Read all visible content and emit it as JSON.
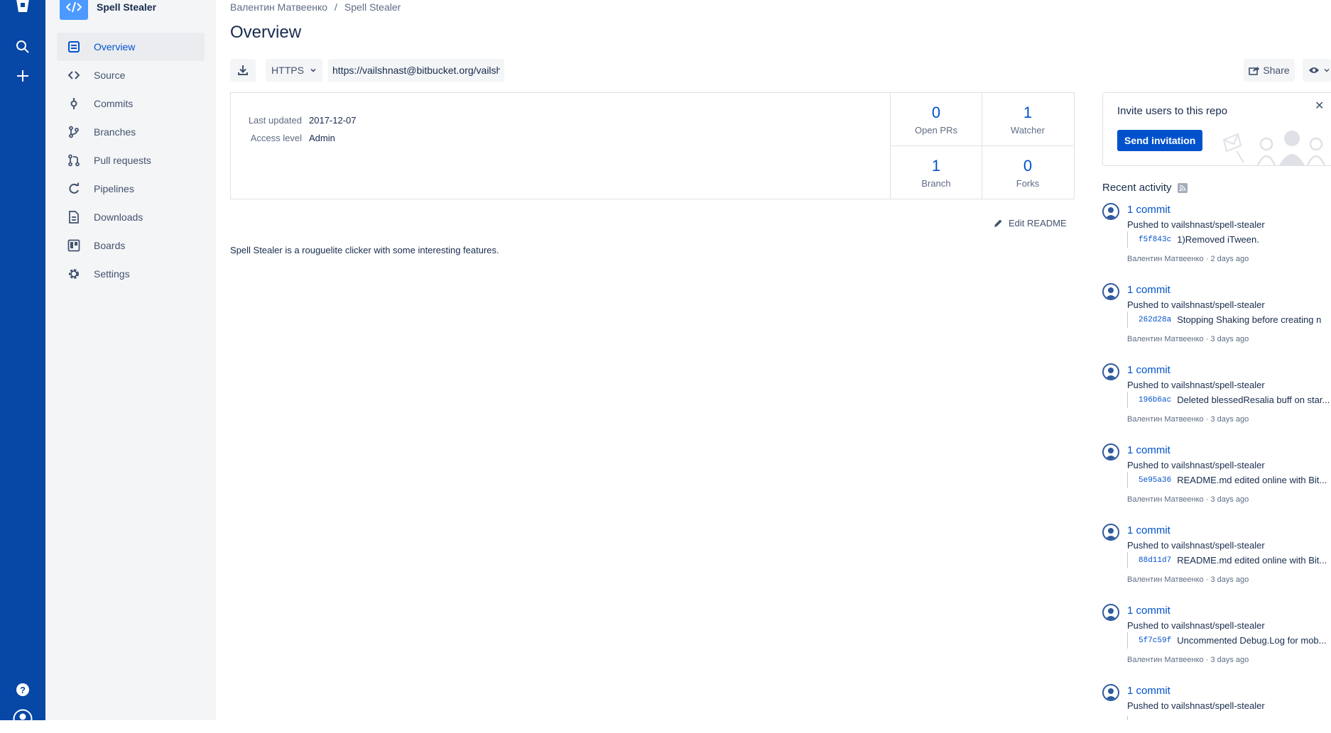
{
  "repo": {
    "name": "Spell Stealer",
    "avatar_icon": "code-icon"
  },
  "sidebar": {
    "items": [
      {
        "label": "Overview",
        "icon": "overview-icon"
      },
      {
        "label": "Source",
        "icon": "source-icon"
      },
      {
        "label": "Commits",
        "icon": "commits-icon"
      },
      {
        "label": "Branches",
        "icon": "branches-icon"
      },
      {
        "label": "Pull requests",
        "icon": "pull-requests-icon"
      },
      {
        "label": "Pipelines",
        "icon": "pipelines-icon"
      },
      {
        "label": "Downloads",
        "icon": "downloads-icon"
      },
      {
        "label": "Boards",
        "icon": "boards-icon"
      },
      {
        "label": "Settings",
        "icon": "settings-icon"
      }
    ]
  },
  "breadcrumb": {
    "owner": "Валентин Матвеенко",
    "separator": "/",
    "repo": "Spell Stealer"
  },
  "page": {
    "title": "Overview"
  },
  "clone": {
    "protocol": "HTTPS",
    "url": "https://vailshnast@bitbucket.org/vailshnast/spell-stealer.git"
  },
  "toolbar": {
    "share_label": "Share"
  },
  "info": {
    "last_updated_label": "Last updated",
    "last_updated_value": "2017-12-07",
    "access_level_label": "Access level",
    "access_level_value": "Admin"
  },
  "stats": {
    "open_prs": {
      "value": "0",
      "label": "Open PRs"
    },
    "watcher": {
      "value": "1",
      "label": "Watcher"
    },
    "branch": {
      "value": "1",
      "label": "Branch"
    },
    "forks": {
      "value": "0",
      "label": "Forks"
    }
  },
  "readme": {
    "edit_label": "Edit README",
    "text": "Spell Stealer is a rouguelite clicker with some interesting features."
  },
  "invite": {
    "title": "Invite users to this repo",
    "button": "Send invitation"
  },
  "activity": {
    "title": "Recent activity",
    "items": [
      {
        "link": "1 commit",
        "pushed": "Pushed to vailshnast/spell-stealer",
        "hash": "f5f843c",
        "message": "1)Removed iTween.",
        "by": "Валентин Матвеенко · 2 days ago"
      },
      {
        "link": "1 commit",
        "pushed": "Pushed to vailshnast/spell-stealer",
        "hash": "262d28a",
        "message": "Stopping Shaking before creating n",
        "by": "Валентин Матвеенко · 3 days ago"
      },
      {
        "link": "1 commit",
        "pushed": "Pushed to vailshnast/spell-stealer",
        "hash": "196b6ac",
        "message": "Deleted blessedResalia buff on star...",
        "by": "Валентин Матвеенко · 3 days ago"
      },
      {
        "link": "1 commit",
        "pushed": "Pushed to vailshnast/spell-stealer",
        "hash": "5e95a36",
        "message": "README.md edited online with Bit...",
        "by": "Валентин Матвеенко · 3 days ago"
      },
      {
        "link": "1 commit",
        "pushed": "Pushed to vailshnast/spell-stealer",
        "hash": "88d11d7",
        "message": "README.md edited online with Bit...",
        "by": "Валентин Матвеенко · 3 days ago"
      },
      {
        "link": "1 commit",
        "pushed": "Pushed to vailshnast/spell-stealer",
        "hash": "5f7c59f",
        "message": "Uncommented Debug.Log for mob...",
        "by": "Валентин Матвеенко · 3 days ago"
      },
      {
        "link": "1 commit",
        "pushed": "Pushed to vailshnast/spell-stealer"
      }
    ]
  }
}
